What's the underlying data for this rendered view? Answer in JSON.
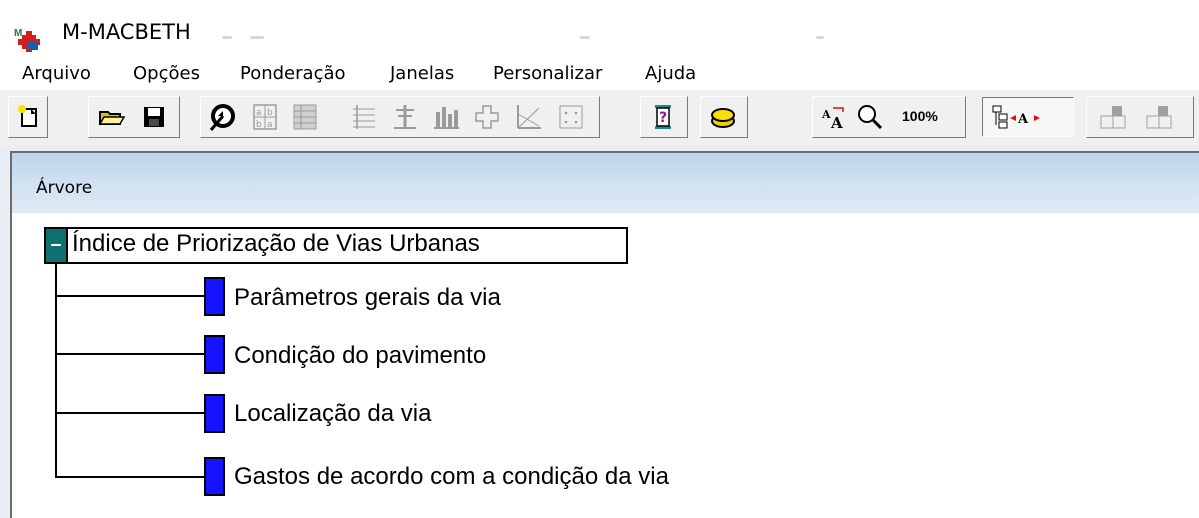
{
  "app": {
    "title": "M-MACBETH",
    "icon_name": "macbeth-logo-icon"
  },
  "menu": {
    "items": [
      "Arquivo",
      "Opções",
      "Ponderação",
      "Janelas",
      "Personalizar",
      "Ajuda"
    ]
  },
  "toolbar": {
    "buttons": [
      "new-file-icon",
      "open-folder-icon",
      "save-disk-icon",
      "direct-scoring-icon",
      "judgements-table-icon",
      "table-grid-icon",
      "scale-table-icon",
      "thermometer-chart-icon",
      "histogram-chart-icon",
      "cross-icon",
      "xy-map-icon",
      "dotted-grid-icon",
      "hourglass-help-icon",
      "coins-icon",
      "font-size-icon",
      "zoom-magnifier-icon",
      "tree-font-icon",
      "disabled-weights-icon",
      "disabled-weights-icon-2"
    ],
    "zoom_label": "100%"
  },
  "tree_window": {
    "title": "Árvore",
    "root": {
      "label": "Índice de Priorização de Vias Urbanas",
      "expanded": true,
      "toggle_color": "#0f7070"
    },
    "children": [
      {
        "label": "Parâmetros gerais da via"
      },
      {
        "label": "Condição do pavimento"
      },
      {
        "label": "Localização da via"
      },
      {
        "label": "Gastos de acordo com a condição da via"
      }
    ],
    "node_color": "#1414ff"
  }
}
